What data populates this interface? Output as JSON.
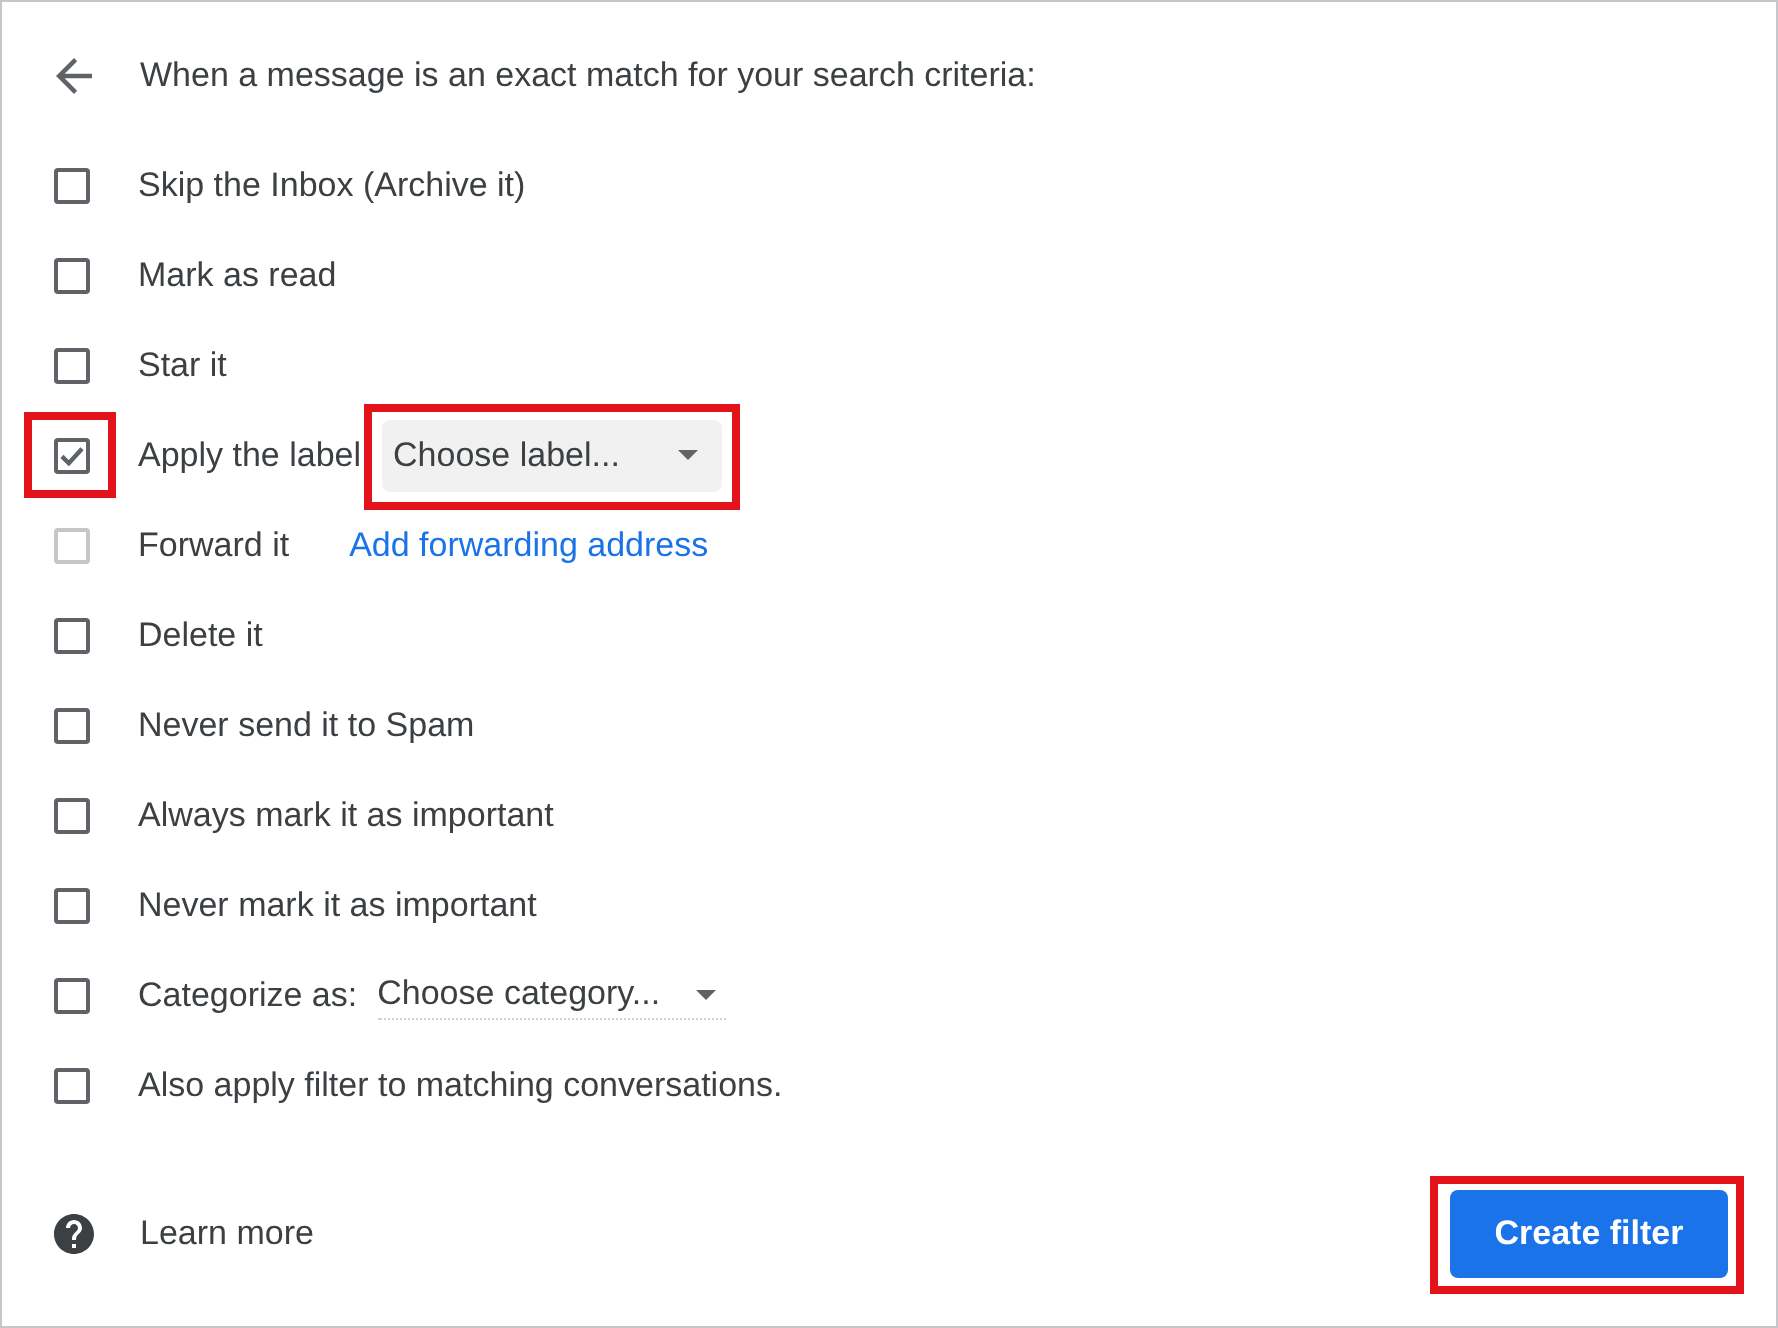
{
  "header": {
    "text": "When a message is an exact match for your search criteria:"
  },
  "actions": [
    {
      "kind": "plain",
      "label": "Skip the Inbox (Archive it)",
      "checked": false,
      "disabled": false,
      "highlighted": false
    },
    {
      "kind": "plain",
      "label": "Mark as read",
      "checked": false,
      "disabled": false,
      "highlighted": false
    },
    {
      "kind": "plain",
      "label": "Star it",
      "checked": false,
      "disabled": false,
      "highlighted": false
    },
    {
      "kind": "labelselect",
      "label": "Apply the label",
      "checked": true,
      "disabled": false,
      "highlighted": true,
      "dropdown": {
        "value": "Choose label...",
        "highlighted": true
      }
    },
    {
      "kind": "link",
      "label": "Forward it",
      "checked": false,
      "disabled": true,
      "highlighted": false,
      "link": "Add forwarding address"
    },
    {
      "kind": "plain",
      "label": "Delete it",
      "checked": false,
      "disabled": false,
      "highlighted": false
    },
    {
      "kind": "plain",
      "label": "Never send it to Spam",
      "checked": false,
      "disabled": false,
      "highlighted": false
    },
    {
      "kind": "plain",
      "label": "Always mark it as important",
      "checked": false,
      "disabled": false,
      "highlighted": false
    },
    {
      "kind": "plain",
      "label": "Never mark it as important",
      "checked": false,
      "disabled": false,
      "highlighted": false
    },
    {
      "kind": "categoryselect",
      "label": "Categorize as:",
      "checked": false,
      "disabled": false,
      "highlighted": false,
      "dropdown": {
        "value": "Choose category...",
        "highlighted": false
      }
    },
    {
      "kind": "plain",
      "label": "Also apply filter to matching conversations.",
      "checked": false,
      "disabled": false,
      "highlighted": false
    }
  ],
  "footer": {
    "help_link": "Learn more",
    "button": {
      "label": "Create filter",
      "highlighted": true
    }
  }
}
